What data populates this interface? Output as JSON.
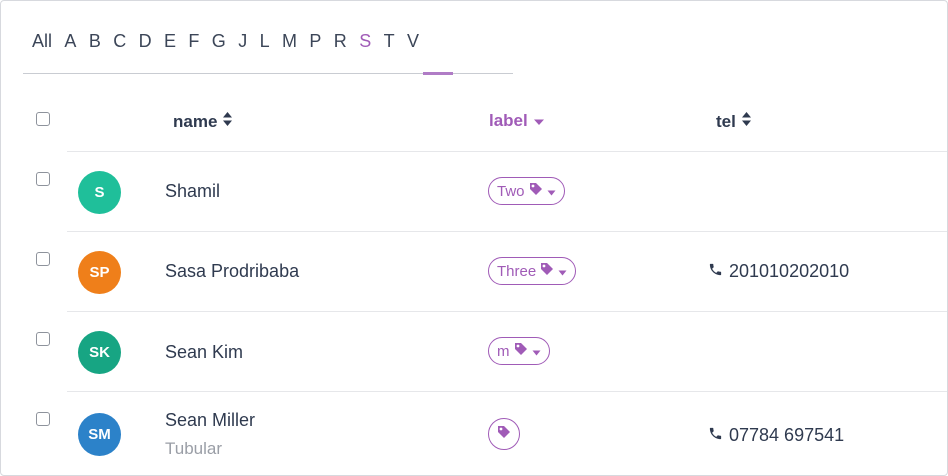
{
  "alphabet": {
    "letters": [
      "All",
      "A",
      "B",
      "C",
      "D",
      "E",
      "F",
      "G",
      "J",
      "L",
      "M",
      "P",
      "R",
      "S",
      "T",
      "V"
    ],
    "active": "S"
  },
  "columns": {
    "name": "name",
    "label": "label",
    "tel": "tel"
  },
  "colors": {
    "accent": "#a05bb7",
    "text": "#2f3a4f"
  },
  "rows": [
    {
      "initials": "S",
      "name": "Shamil",
      "subtitle": "",
      "label": "Two",
      "tel": "",
      "avatar_color": "#1fbf9a"
    },
    {
      "initials": "SP",
      "name": "Sasa Prodribaba",
      "subtitle": "",
      "label": "Three",
      "tel": "201010202010",
      "avatar_color": "#ef7f1a"
    },
    {
      "initials": "SK",
      "name": "Sean Kim",
      "subtitle": "",
      "label": "m",
      "tel": "",
      "avatar_color": "#17a583"
    },
    {
      "initials": "SM",
      "name": "Sean Miller",
      "subtitle": "Tubular",
      "label": "",
      "tel": "07784 697541",
      "avatar_color": "#2c82c9"
    }
  ]
}
